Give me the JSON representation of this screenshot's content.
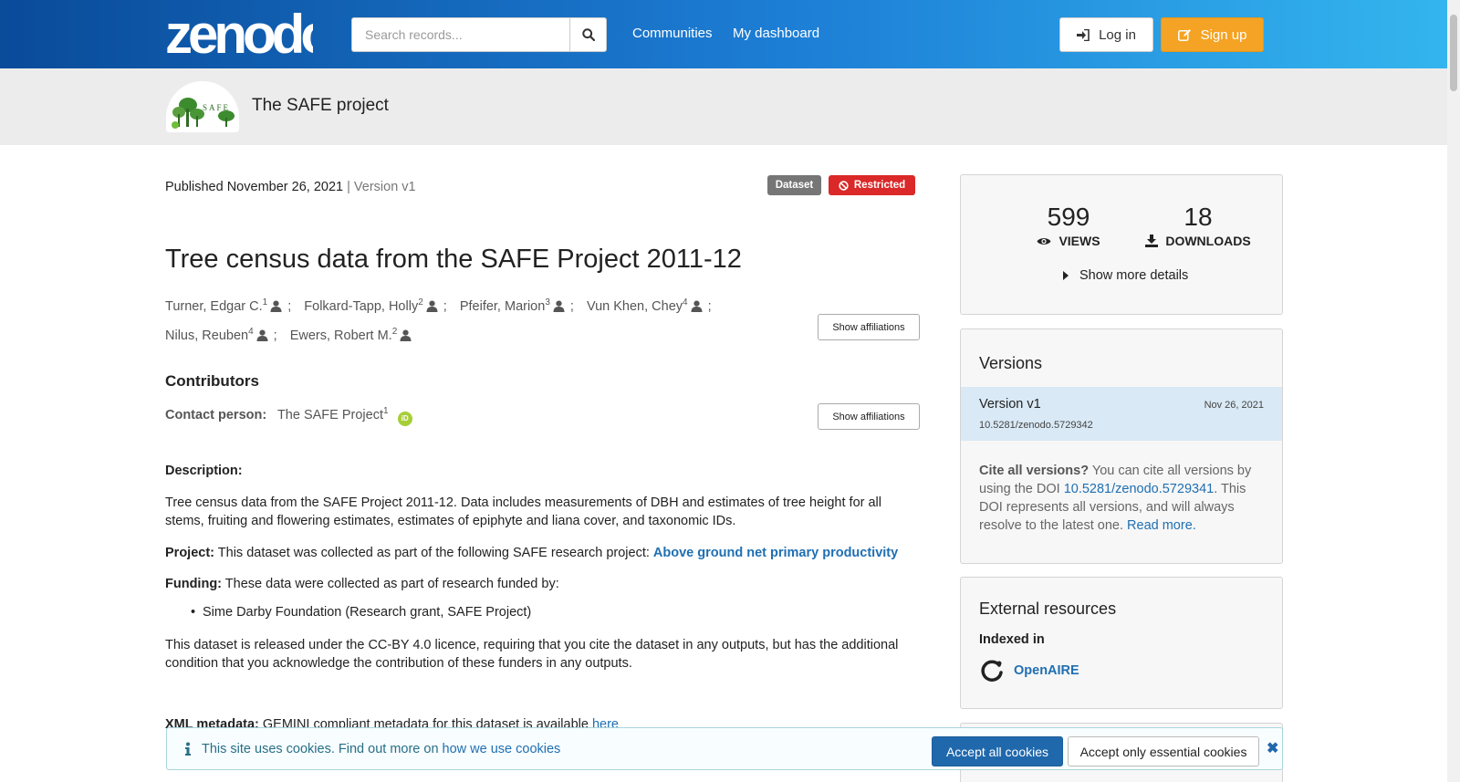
{
  "header": {
    "logo_text": "zenodo",
    "search_placeholder": "Search records...",
    "nav": [
      "Communities",
      "My dashboard"
    ],
    "login_label": "Log in",
    "signup_label": "Sign up"
  },
  "community": {
    "logo_text": "SAFE",
    "title": "The SAFE project"
  },
  "record": {
    "published": "Published November 26, 2021",
    "version": "Version v1",
    "badge_type": "Dataset",
    "badge_access": "Restricted",
    "title": "Tree census data from the SAFE Project 2011-12",
    "authors": [
      {
        "name": "Turner, Edgar C.",
        "aff": "1"
      },
      {
        "name": "Folkard-Tapp, Holly",
        "aff": "2"
      },
      {
        "name": "Pfeifer, Marion",
        "aff": "3"
      },
      {
        "name": "Vun Khen, Chey",
        "aff": "4"
      },
      {
        "name": "Nilus, Reuben",
        "aff": "4"
      },
      {
        "name": "Ewers, Robert M.",
        "aff": "2"
      }
    ],
    "author_separator": ";",
    "show_affiliations": "Show affiliations",
    "contributors_heading": "Contributors",
    "contact_label": "Contact person:",
    "contact_name": "The SAFE Project",
    "contact_aff": "1",
    "orcid_text": "iD",
    "description_heading": "Description:",
    "description": "Tree census data from the SAFE Project 2011-12. Data includes measurements of DBH and estimates of tree height for all stems, fruiting and flowering estimates, estimates of epiphyte and liana cover, and taxonomic IDs.",
    "project_label": "Project:",
    "project_text": "This dataset was collected as part of the following SAFE research project:",
    "project_link": "Above ground net primary productivity",
    "funding_label": "Funding:",
    "funding_text": "These data were collected as part of research funded by:",
    "funding_items": [
      "Sime Darby Foundation (Research grant, SAFE Project)"
    ],
    "licence_text": "This dataset is released under the CC-BY 4.0 licence, requiring that you cite the dataset in any outputs, but has the additional condition that you acknowledge the contribution of these funders in any outputs.",
    "xml_label": "XML metadata:",
    "xml_text": "GEMINI compliant metadata for this dataset is available",
    "xml_link": "here"
  },
  "stats": {
    "views": "599",
    "views_label": "VIEWS",
    "downloads": "18",
    "downloads_label": "DOWNLOADS",
    "show_more": "Show more details"
  },
  "versions": {
    "heading": "Versions",
    "items": [
      {
        "label": "Version v1",
        "doi": "10.5281/zenodo.5729342",
        "date": "Nov 26, 2021"
      }
    ],
    "cite_bold": "Cite all versions?",
    "cite_text_1": "You can cite all versions by using the DOI",
    "cite_doi": "10.5281/zenodo.5729341",
    "cite_text_2": ". This DOI represents all versions, and will always resolve to the latest one.",
    "read_more": "Read more."
  },
  "external": {
    "heading": "External resources",
    "indexed_label": "Indexed in",
    "openaire": "OpenAIRE"
  },
  "cookie": {
    "text": "This site uses cookies. Find out more on",
    "link": "how we use cookies",
    "accept_all": "Accept all cookies",
    "accept_essential": "Accept only essential cookies",
    "close": "✖"
  },
  "colors": {
    "header_start": "#0a4b9a",
    "header_end": "#34b6ef",
    "signup": "#f5a324",
    "restricted": "#db2828",
    "link": "#1f6fb2"
  }
}
